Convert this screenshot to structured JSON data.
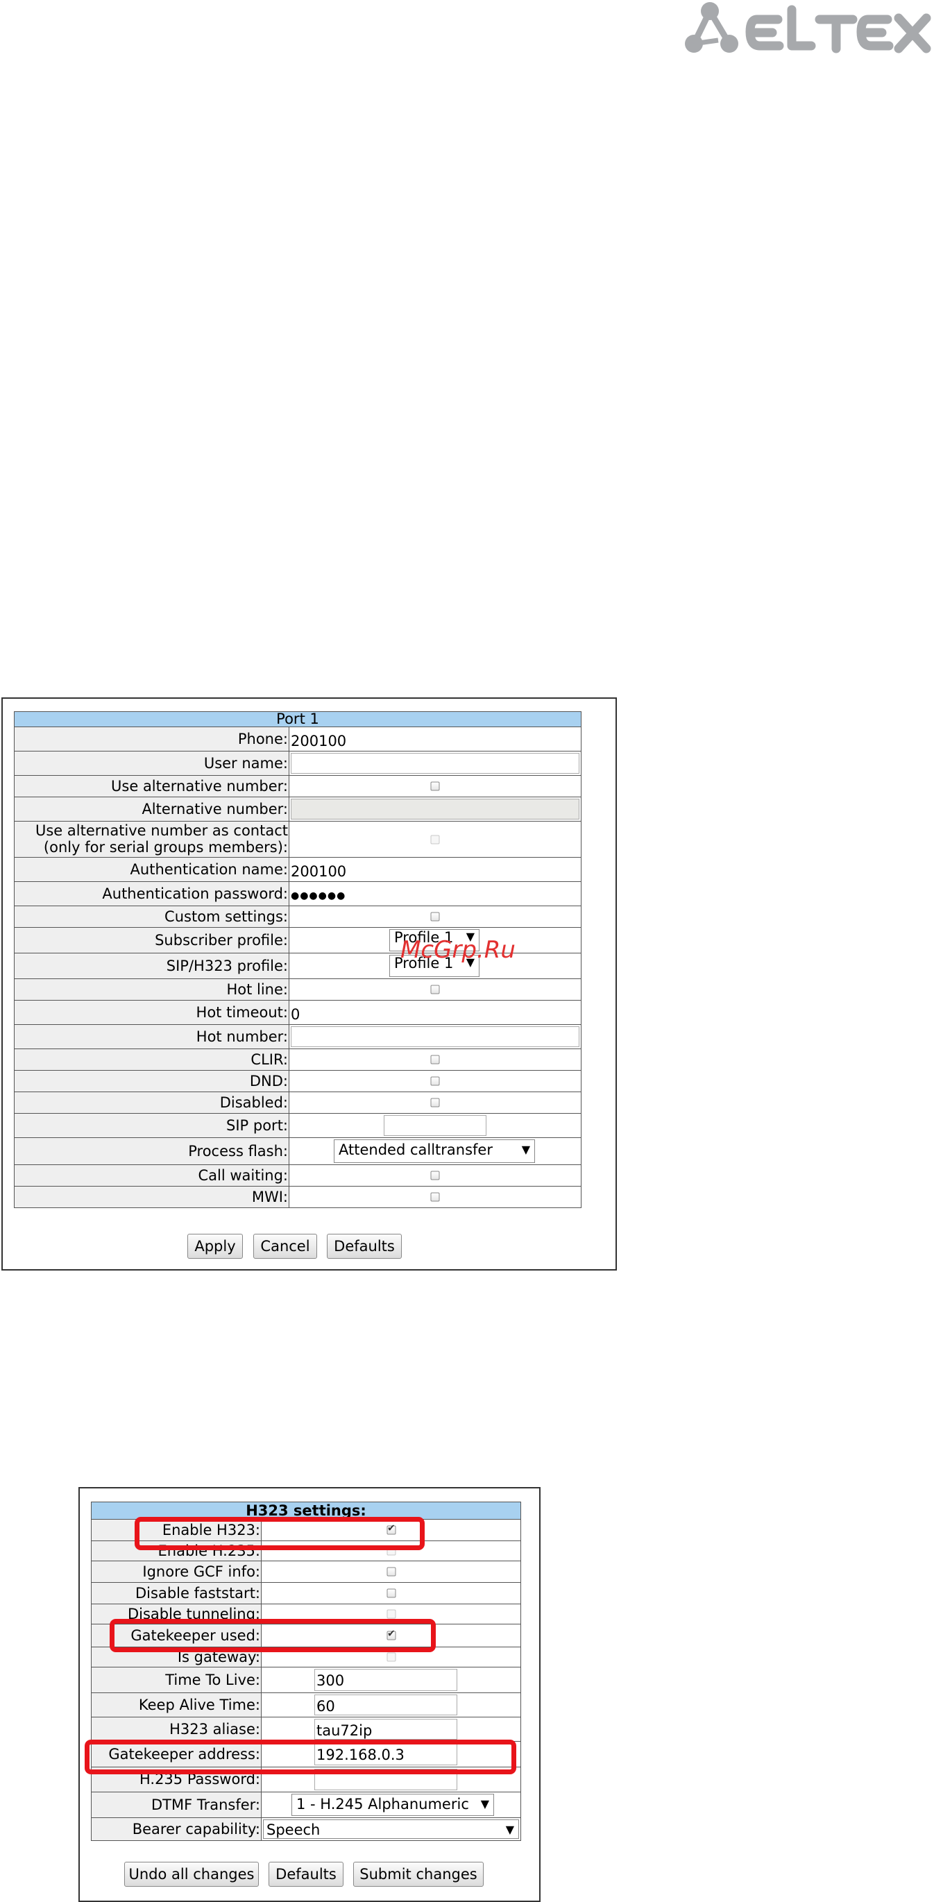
{
  "brand": {
    "name": "ELTEX",
    "logo_color": "#a7a9ac"
  },
  "watermark": "McGrp.Ru",
  "port": {
    "title": "Port 1",
    "rows": [
      {
        "label": "Phone:",
        "value": "200100"
      },
      {
        "label": "User name:",
        "value": ""
      },
      {
        "label": "Use alternative number:",
        "checked": false
      },
      {
        "label": "Alternative number:",
        "value": ""
      },
      {
        "label_line1": "Use alternative number as contact",
        "label_line2": "(only for serial groups members):",
        "checked": false
      },
      {
        "label": "Authentication name:",
        "value": "200100"
      },
      {
        "label": "Authentication password:",
        "value": "●●●●●●"
      },
      {
        "label": "Custom settings:",
        "checked": false
      },
      {
        "label": "Subscriber profile:",
        "value": "Profile 1"
      },
      {
        "label": "SIP/H323 profile:",
        "value": "Profile 1"
      },
      {
        "label": "Hot line:",
        "checked": false
      },
      {
        "label": "Hot timeout:",
        "value": "0"
      },
      {
        "label": "Hot number:",
        "value": ""
      },
      {
        "label": "CLIR:",
        "checked": false
      },
      {
        "label": "DND:",
        "checked": false
      },
      {
        "label": "Disabled:",
        "checked": false
      },
      {
        "label": "SIP port:",
        "value": ""
      },
      {
        "label": "Process flash:",
        "value": "Attended calltransfer"
      },
      {
        "label": "Call waiting:",
        "checked": false
      },
      {
        "label": "MWI:",
        "checked": false
      }
    ],
    "buttons": {
      "apply": "Apply",
      "cancel": "Cancel",
      "defaults": "Defaults"
    }
  },
  "h323": {
    "title": "H323 settings:",
    "rows": [
      {
        "label": "Enable H323:",
        "checked": true
      },
      {
        "label": "Enable H.235:",
        "checked": false
      },
      {
        "label": "Ignore GCF info:",
        "checked": false
      },
      {
        "label": "Disable faststart:",
        "checked": false
      },
      {
        "label": "Disable tunneling:",
        "checked": false
      },
      {
        "label": "Gatekeeper used:",
        "checked": true
      },
      {
        "label": "Is gateway:",
        "checked": false
      },
      {
        "label": "Time To Live:",
        "value": "300"
      },
      {
        "label": "Keep Alive Time:",
        "value": "60"
      },
      {
        "label": "H323 aliase:",
        "value": "tau72ip"
      },
      {
        "label": "Gatekeeper address:",
        "value": "192.168.0.3"
      },
      {
        "label": "H.235 Password:",
        "value": ""
      },
      {
        "label": "DTMF Transfer:",
        "value": "1 - H.245 Alphanumeric"
      },
      {
        "label": "Bearer capability:",
        "value": "Speech"
      }
    ],
    "buttons": {
      "undo": "Undo all changes",
      "defaults": "Defaults",
      "submit": "Submit changes"
    }
  },
  "highlight_color": "#e8141a"
}
